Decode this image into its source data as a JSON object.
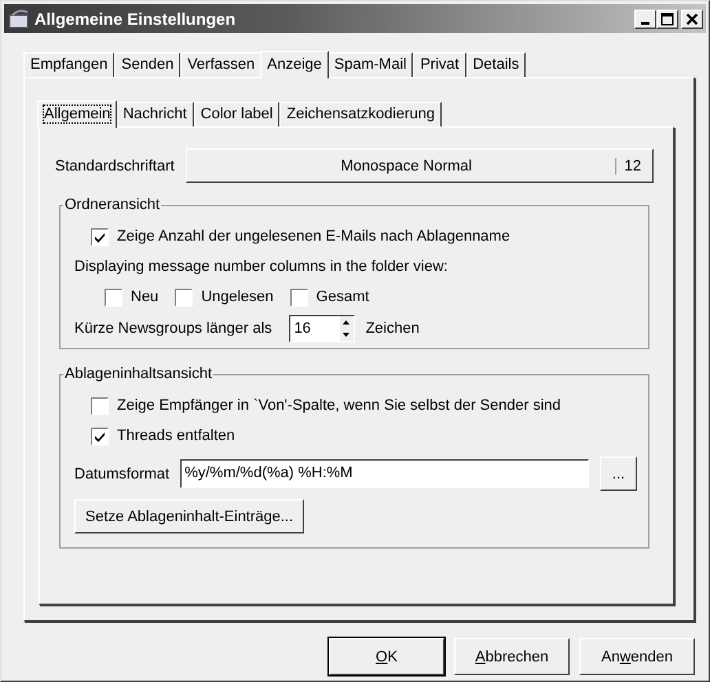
{
  "window": {
    "title": "Allgemeine Einstellungen"
  },
  "tabs": [
    {
      "label": "Empfangen",
      "selected": false
    },
    {
      "label": "Senden",
      "selected": false
    },
    {
      "label": "Verfassen",
      "selected": false
    },
    {
      "label": "Anzeige",
      "selected": true
    },
    {
      "label": "Spam-Mail",
      "selected": false
    },
    {
      "label": "Privat",
      "selected": false
    },
    {
      "label": "Details",
      "selected": false
    }
  ],
  "subtabs": [
    {
      "label": "Allgemein",
      "selected": true
    },
    {
      "label": "Nachricht",
      "selected": false
    },
    {
      "label": "Color label",
      "selected": false
    },
    {
      "label": "Zeichensatzkodierung",
      "selected": false
    }
  ],
  "font_row": {
    "label": "Standardschriftart",
    "font": "Monospace Normal",
    "size": "12"
  },
  "folder_view": {
    "title": "Ordneransicht",
    "unread_count": {
      "label": "Zeige Anzahl der ungelesenen E-Mails nach Ablagenname",
      "checked": true
    },
    "columns_label": "Displaying message number columns in the folder view:",
    "columns": [
      {
        "label": "Neu",
        "checked": false
      },
      {
        "label": "Ungelesen",
        "checked": false
      },
      {
        "label": "Gesamt",
        "checked": false
      }
    ],
    "shorten": {
      "label": "Kürze Newsgroups länger als",
      "value": "16",
      "unit": "Zeichen"
    }
  },
  "content_view": {
    "title": "Ablageninhaltsansicht",
    "checks": [
      {
        "label": "Zeige Empfänger in `Von'-Spalte, wenn Sie selbst der Sender sind",
        "checked": false
      },
      {
        "label": "Threads entfalten",
        "checked": true
      }
    ],
    "date_format": {
      "label": "Datumsformat",
      "value": "%y/%m/%d(%a) %H:%M",
      "browse": "..."
    },
    "set_button": "Setze Ablageninhalt-Einträge..."
  },
  "buttons": [
    {
      "key": "O",
      "after": "K",
      "default": true
    },
    {
      "key": "A",
      "after": "bbrechen",
      "default": false
    },
    {
      "before": "An",
      "key": "w",
      "after": "enden",
      "default": false
    }
  ]
}
